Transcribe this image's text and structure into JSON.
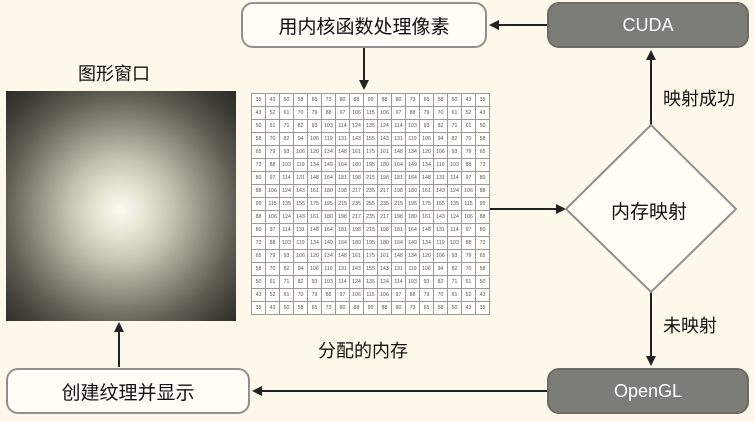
{
  "nodes": {
    "kernel": "用内核函数处理像素",
    "cuda": "CUDA",
    "opengl": "OpenGL",
    "render": "创建纹理并显示",
    "decision": "内存映射"
  },
  "labels": {
    "window": "图形窗口",
    "memory": "分配的内存",
    "map_success": "映射成功",
    "not_mapped": "未映射"
  },
  "colors": {
    "background": "#fdf8ea",
    "dark_box": "#7d7d78",
    "light_box": "#fffdf5",
    "arrow": "#222222"
  },
  "chart_data": {
    "type": "table",
    "title": "分配的内存",
    "rows": [
      [
        35,
        43,
        50,
        58,
        65,
        73,
        80,
        88,
        95,
        88,
        80,
        73,
        65,
        58,
        50,
        43,
        35
      ],
      [
        43,
        52,
        61,
        70,
        79,
        88,
        97,
        106,
        115,
        106,
        97,
        88,
        79,
        70,
        61,
        52,
        43
      ],
      [
        50,
        61,
        71,
        82,
        93,
        103,
        114,
        124,
        135,
        124,
        114,
        103,
        93,
        82,
        71,
        61,
        50
      ],
      [
        58,
        70,
        82,
        94,
        106,
        119,
        131,
        143,
        155,
        143,
        131,
        119,
        106,
        94,
        82,
        70,
        58
      ],
      [
        65,
        79,
        93,
        106,
        120,
        134,
        148,
        161,
        175,
        161,
        148,
        134,
        120,
        106,
        93,
        79,
        65
      ],
      [
        73,
        88,
        103,
        119,
        134,
        149,
        164,
        180,
        195,
        180,
        164,
        149,
        134,
        119,
        103,
        88,
        73
      ],
      [
        80,
        97,
        114,
        131,
        148,
        164,
        181,
        198,
        215,
        198,
        181,
        164,
        148,
        131,
        114,
        97,
        80
      ],
      [
        88,
        106,
        124,
        143,
        161,
        180,
        198,
        217,
        235,
        217,
        198,
        180,
        161,
        143,
        124,
        106,
        88
      ],
      [
        95,
        115,
        135,
        155,
        175,
        195,
        215,
        235,
        255,
        235,
        215,
        195,
        175,
        155,
        135,
        115,
        95
      ],
      [
        88,
        106,
        124,
        143,
        161,
        180,
        198,
        217,
        235,
        217,
        198,
        180,
        161,
        143,
        124,
        106,
        88
      ],
      [
        80,
        97,
        114,
        131,
        148,
        164,
        181,
        198,
        215,
        198,
        181,
        164,
        148,
        131,
        114,
        97,
        80
      ],
      [
        73,
        88,
        103,
        119,
        134,
        149,
        164,
        180,
        195,
        180,
        164,
        149,
        134,
        119,
        103,
        88,
        73
      ],
      [
        65,
        79,
        93,
        106,
        120,
        134,
        148,
        161,
        175,
        161,
        148,
        134,
        120,
        106,
        93,
        79,
        65
      ],
      [
        58,
        70,
        82,
        94,
        106,
        119,
        131,
        143,
        155,
        143,
        131,
        119,
        106,
        94,
        82,
        70,
        58
      ],
      [
        50,
        61,
        71,
        82,
        93,
        103,
        114,
        124,
        135,
        124,
        114,
        103,
        93,
        82,
        71,
        61,
        50
      ],
      [
        43,
        52,
        61,
        70,
        79,
        88,
        97,
        106,
        115,
        106,
        97,
        88,
        79,
        70,
        61,
        52,
        43
      ],
      [
        35,
        43,
        50,
        58,
        65,
        73,
        80,
        88,
        95,
        88,
        80,
        73,
        65,
        58,
        50,
        43,
        35
      ]
    ]
  }
}
